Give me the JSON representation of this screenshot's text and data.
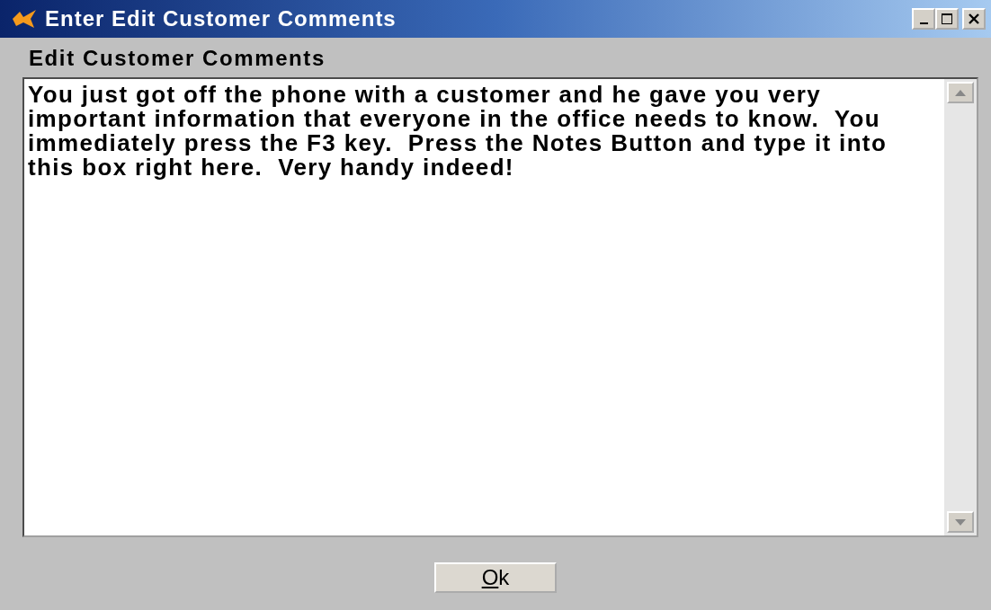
{
  "window": {
    "title": "Enter Edit Customer Comments"
  },
  "field_label": "Edit Customer Comments",
  "comments": {
    "value": "You just got off the phone with a customer and he gave you very important information that everyone in the office needs to know.  You immediately press the F3 key.  Press the Notes Button and type it into this box right here.  Very handy indeed!"
  },
  "buttons": [
    {
      "label_parts": [
        {
          "text": "O",
          "underlined": true
        },
        {
          "text": "k",
          "underlined": false
        }
      ]
    }
  ]
}
